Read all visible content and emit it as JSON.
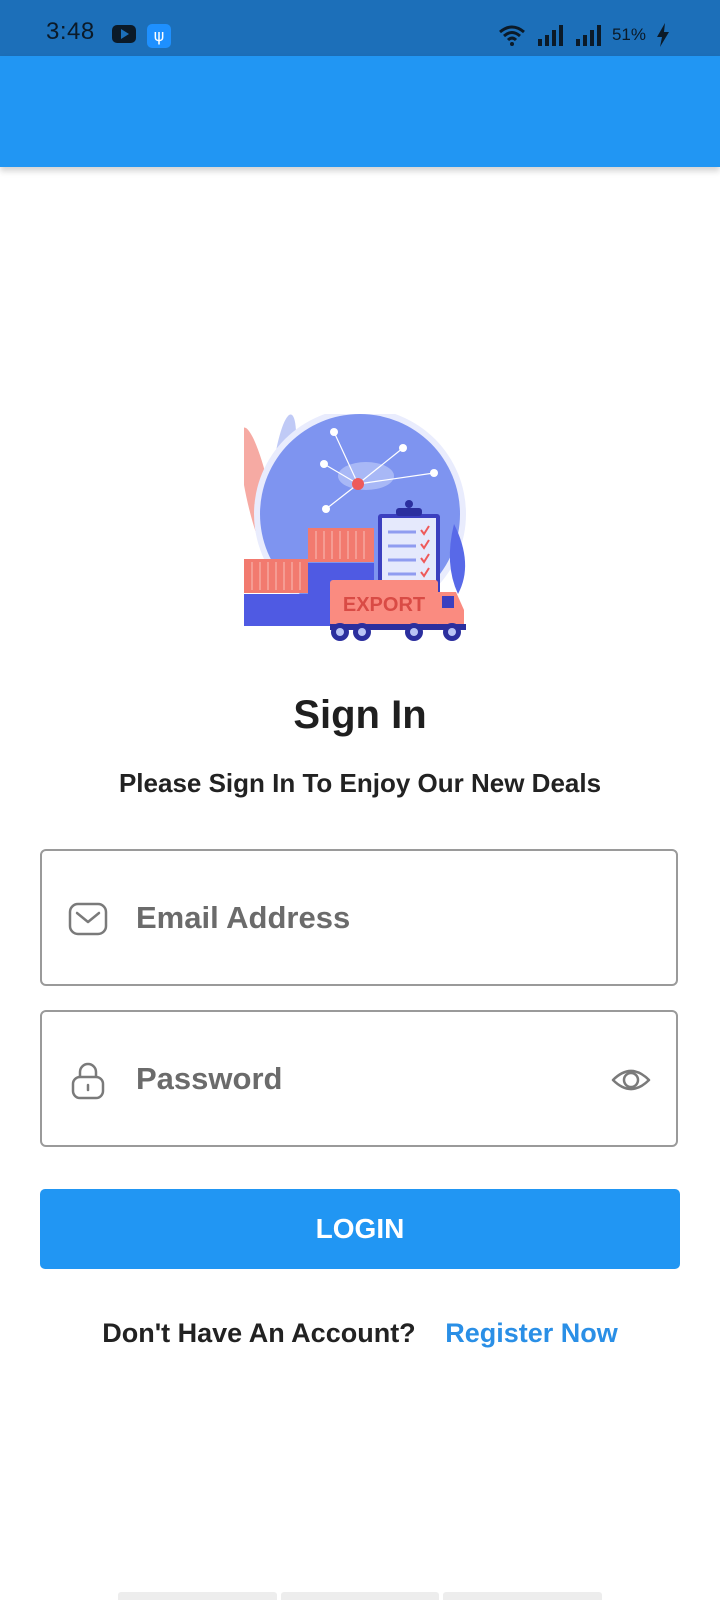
{
  "status_bar": {
    "time": "3:48",
    "battery_percent": "51%",
    "icons": [
      "youtube-icon",
      "usb-icon",
      "wifi-icon",
      "signal-icon",
      "signal-icon",
      "charging-icon"
    ]
  },
  "app_bar": {
    "color": "#2196f3"
  },
  "hero": {
    "badge_text": "EXPORT"
  },
  "signin": {
    "title": "Sign In",
    "subtitle": "Please Sign In To Enjoy Our New Deals"
  },
  "email": {
    "placeholder": "Email Address",
    "value": "",
    "icon": "mail-icon"
  },
  "password": {
    "placeholder": "Password",
    "value": "",
    "icon": "lock-icon",
    "toggle_icon": "eye-icon"
  },
  "login_button": {
    "label": "LOGIN"
  },
  "register": {
    "prompt": "Don't Have An Account?",
    "link": "Register Now"
  },
  "colors": {
    "primary": "#2196f3",
    "status_bar": "#1c6fb9",
    "link": "#2a8fe6",
    "border": "#9a9a9a"
  }
}
